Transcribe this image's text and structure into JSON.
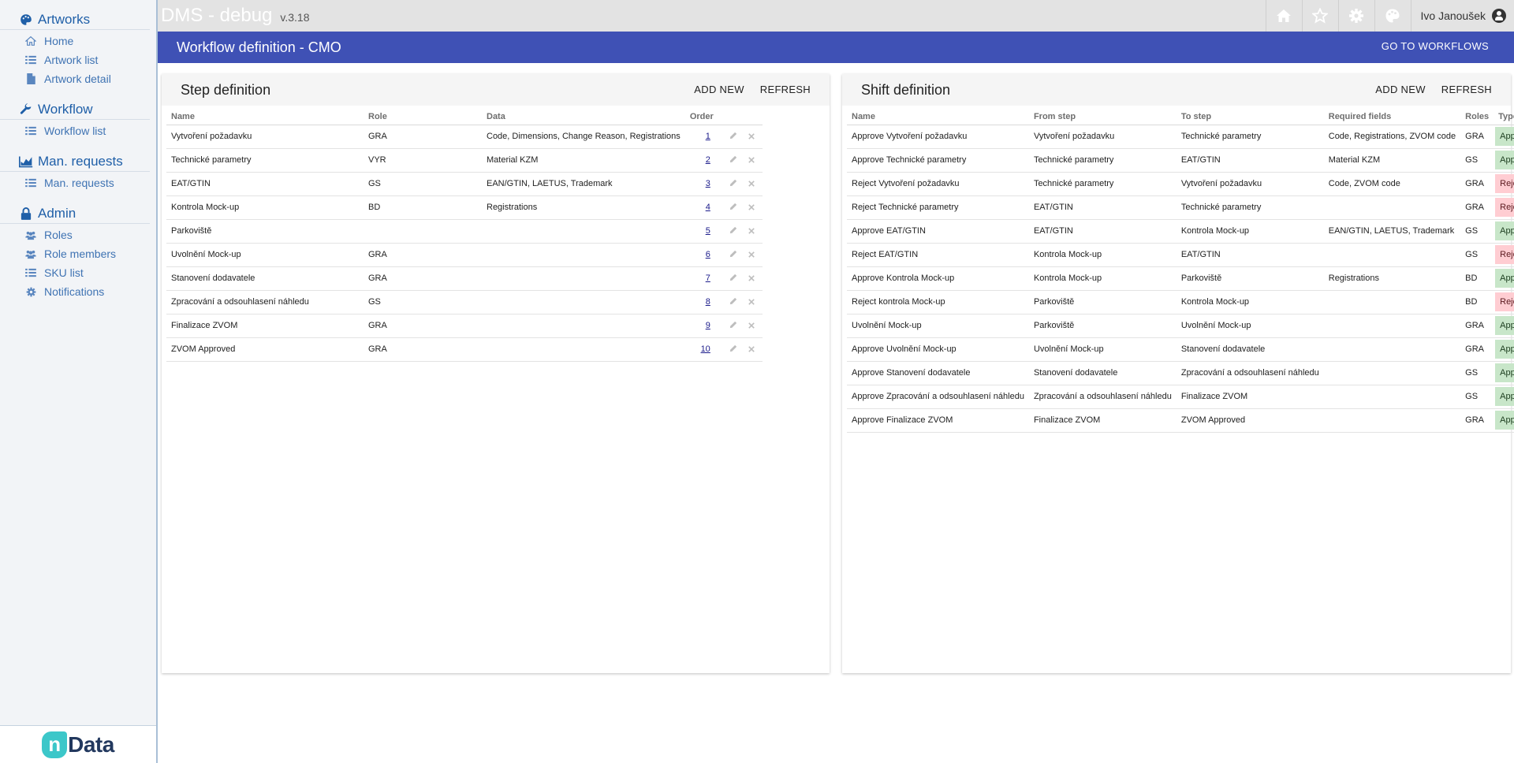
{
  "sidebar": {
    "sections": [
      {
        "title": "Artworks",
        "icon": "palette-icon",
        "items": [
          {
            "label": "Home",
            "icon": "home-icon"
          },
          {
            "label": "Artwork list",
            "icon": "list-icon"
          },
          {
            "label": "Artwork detail",
            "icon": "file-icon"
          }
        ]
      },
      {
        "title": "Workflow",
        "icon": "wrench-icon",
        "items": [
          {
            "label": "Workflow list",
            "icon": "list-icon"
          }
        ]
      },
      {
        "title": "Man. requests",
        "icon": "chart-icon",
        "items": [
          {
            "label": "Man. requests",
            "icon": "list-icon"
          }
        ]
      },
      {
        "title": "Admin",
        "icon": "lock-icon",
        "items": [
          {
            "label": "Roles",
            "icon": "users-icon"
          },
          {
            "label": "Role members",
            "icon": "users-icon"
          },
          {
            "label": "SKU list",
            "icon": "list-icon"
          },
          {
            "label": "Notifications",
            "icon": "gear-icon"
          }
        ]
      }
    ],
    "brand": {
      "mark": "n",
      "text": "Data"
    }
  },
  "topbar": {
    "title": "DMS - debug",
    "version": "v.3.18",
    "user": "Ivo Janoušek"
  },
  "header": {
    "title": "Workflow definition - CMO",
    "goto_label": "GO TO WORKFLOWS"
  },
  "steps": {
    "title": "Step definition",
    "add_label": "ADD NEW",
    "refresh_label": "REFRESH",
    "columns": [
      "Name",
      "Role",
      "Data",
      "Order"
    ],
    "rows": [
      {
        "name": "Vytvoření požadavku",
        "role": "GRA",
        "data": "Code, Dimensions, Change Reason, Registrations",
        "order": "1"
      },
      {
        "name": "Technické parametry",
        "role": "VYR",
        "data": "Material KZM",
        "order": "2"
      },
      {
        "name": "EAT/GTIN",
        "role": "GS",
        "data": "EAN/GTIN, LAETUS, Trademark",
        "order": "3"
      },
      {
        "name": "Kontrola Mock-up",
        "role": "BD",
        "data": "Registrations",
        "order": "4"
      },
      {
        "name": "Parkoviště",
        "role": "",
        "data": "",
        "order": "5"
      },
      {
        "name": "Uvolnění Mock-up",
        "role": "GRA",
        "data": "",
        "order": "6"
      },
      {
        "name": "Stanovení dodavatele",
        "role": "GRA",
        "data": "",
        "order": "7"
      },
      {
        "name": "Zpracování a odsouhlasení náhledu",
        "role": "GS",
        "data": "",
        "order": "8"
      },
      {
        "name": "Finalizace ZVOM",
        "role": "GRA",
        "data": "",
        "order": "9"
      },
      {
        "name": "ZVOM Approved",
        "role": "GRA",
        "data": "",
        "order": "10"
      }
    ]
  },
  "shifts": {
    "title": "Shift definition",
    "add_label": "ADD NEW",
    "refresh_label": "REFRESH",
    "columns": [
      "Name",
      "From step",
      "To step",
      "Required fields",
      "Roles",
      "Type"
    ],
    "rows": [
      {
        "name": "Approve Vytvoření požadavku",
        "from": "Vytvoření požadavku",
        "to": "Technické parametry",
        "fields": "Code, Registrations, ZVOM code",
        "roles": "GRA",
        "type": "Approve"
      },
      {
        "name": "Approve Technické parametry",
        "from": "Technické parametry",
        "to": "EAT/GTIN",
        "fields": "Material KZM",
        "roles": "GS",
        "type": "Approve"
      },
      {
        "name": "Reject Vytvoření požadavku",
        "from": "Technické parametry",
        "to": "Vytvoření požadavku",
        "fields": "Code, ZVOM code",
        "roles": "GRA",
        "type": "Reject"
      },
      {
        "name": "Reject Technické parametry",
        "from": "EAT/GTIN",
        "to": "Technické parametry",
        "fields": "",
        "roles": "GRA",
        "type": "Reject"
      },
      {
        "name": "Approve EAT/GTIN",
        "from": "EAT/GTIN",
        "to": "Kontrola Mock-up",
        "fields": "EAN/GTIN, LAETUS, Trademark",
        "roles": "GS",
        "type": "Approve"
      },
      {
        "name": "Reject EAT/GTIN",
        "from": "Kontrola Mock-up",
        "to": "EAT/GTIN",
        "fields": "",
        "roles": "GS",
        "type": "Reject"
      },
      {
        "name": "Approve Kontrola Mock-up",
        "from": "Kontrola Mock-up",
        "to": "Parkoviště",
        "fields": "Registrations",
        "roles": "BD",
        "type": "Approve"
      },
      {
        "name": "Reject kontrola Mock-up",
        "from": "Parkoviště",
        "to": "Kontrola Mock-up",
        "fields": "",
        "roles": "BD",
        "type": "Reject"
      },
      {
        "name": "Uvolnění Mock-up",
        "from": "Parkoviště",
        "to": "Uvolnění Mock-up",
        "fields": "",
        "roles": "GRA",
        "type": "Approve"
      },
      {
        "name": "Approve Uvolnění Mock-up",
        "from": "Uvolnění Mock-up",
        "to": "Stanovení dodavatele",
        "fields": "",
        "roles": "GRA",
        "type": "Approve"
      },
      {
        "name": "Approve Stanovení dodavatele",
        "from": "Stanovení dodavatele",
        "to": "Zpracování a odsouhlasení náhledu",
        "fields": "",
        "roles": "GS",
        "type": "Approve"
      },
      {
        "name": "Approve Zpracování a odsouhlasení náhledu",
        "from": "Zpracování a odsouhlasení náhledu",
        "to": "Finalizace ZVOM",
        "fields": "",
        "roles": "GS",
        "type": "Approve"
      },
      {
        "name": "Approve Finalizace ZVOM",
        "from": "Finalizace ZVOM",
        "to": "ZVOM Approved",
        "fields": "",
        "roles": "GRA",
        "type": "Approve"
      }
    ]
  }
}
